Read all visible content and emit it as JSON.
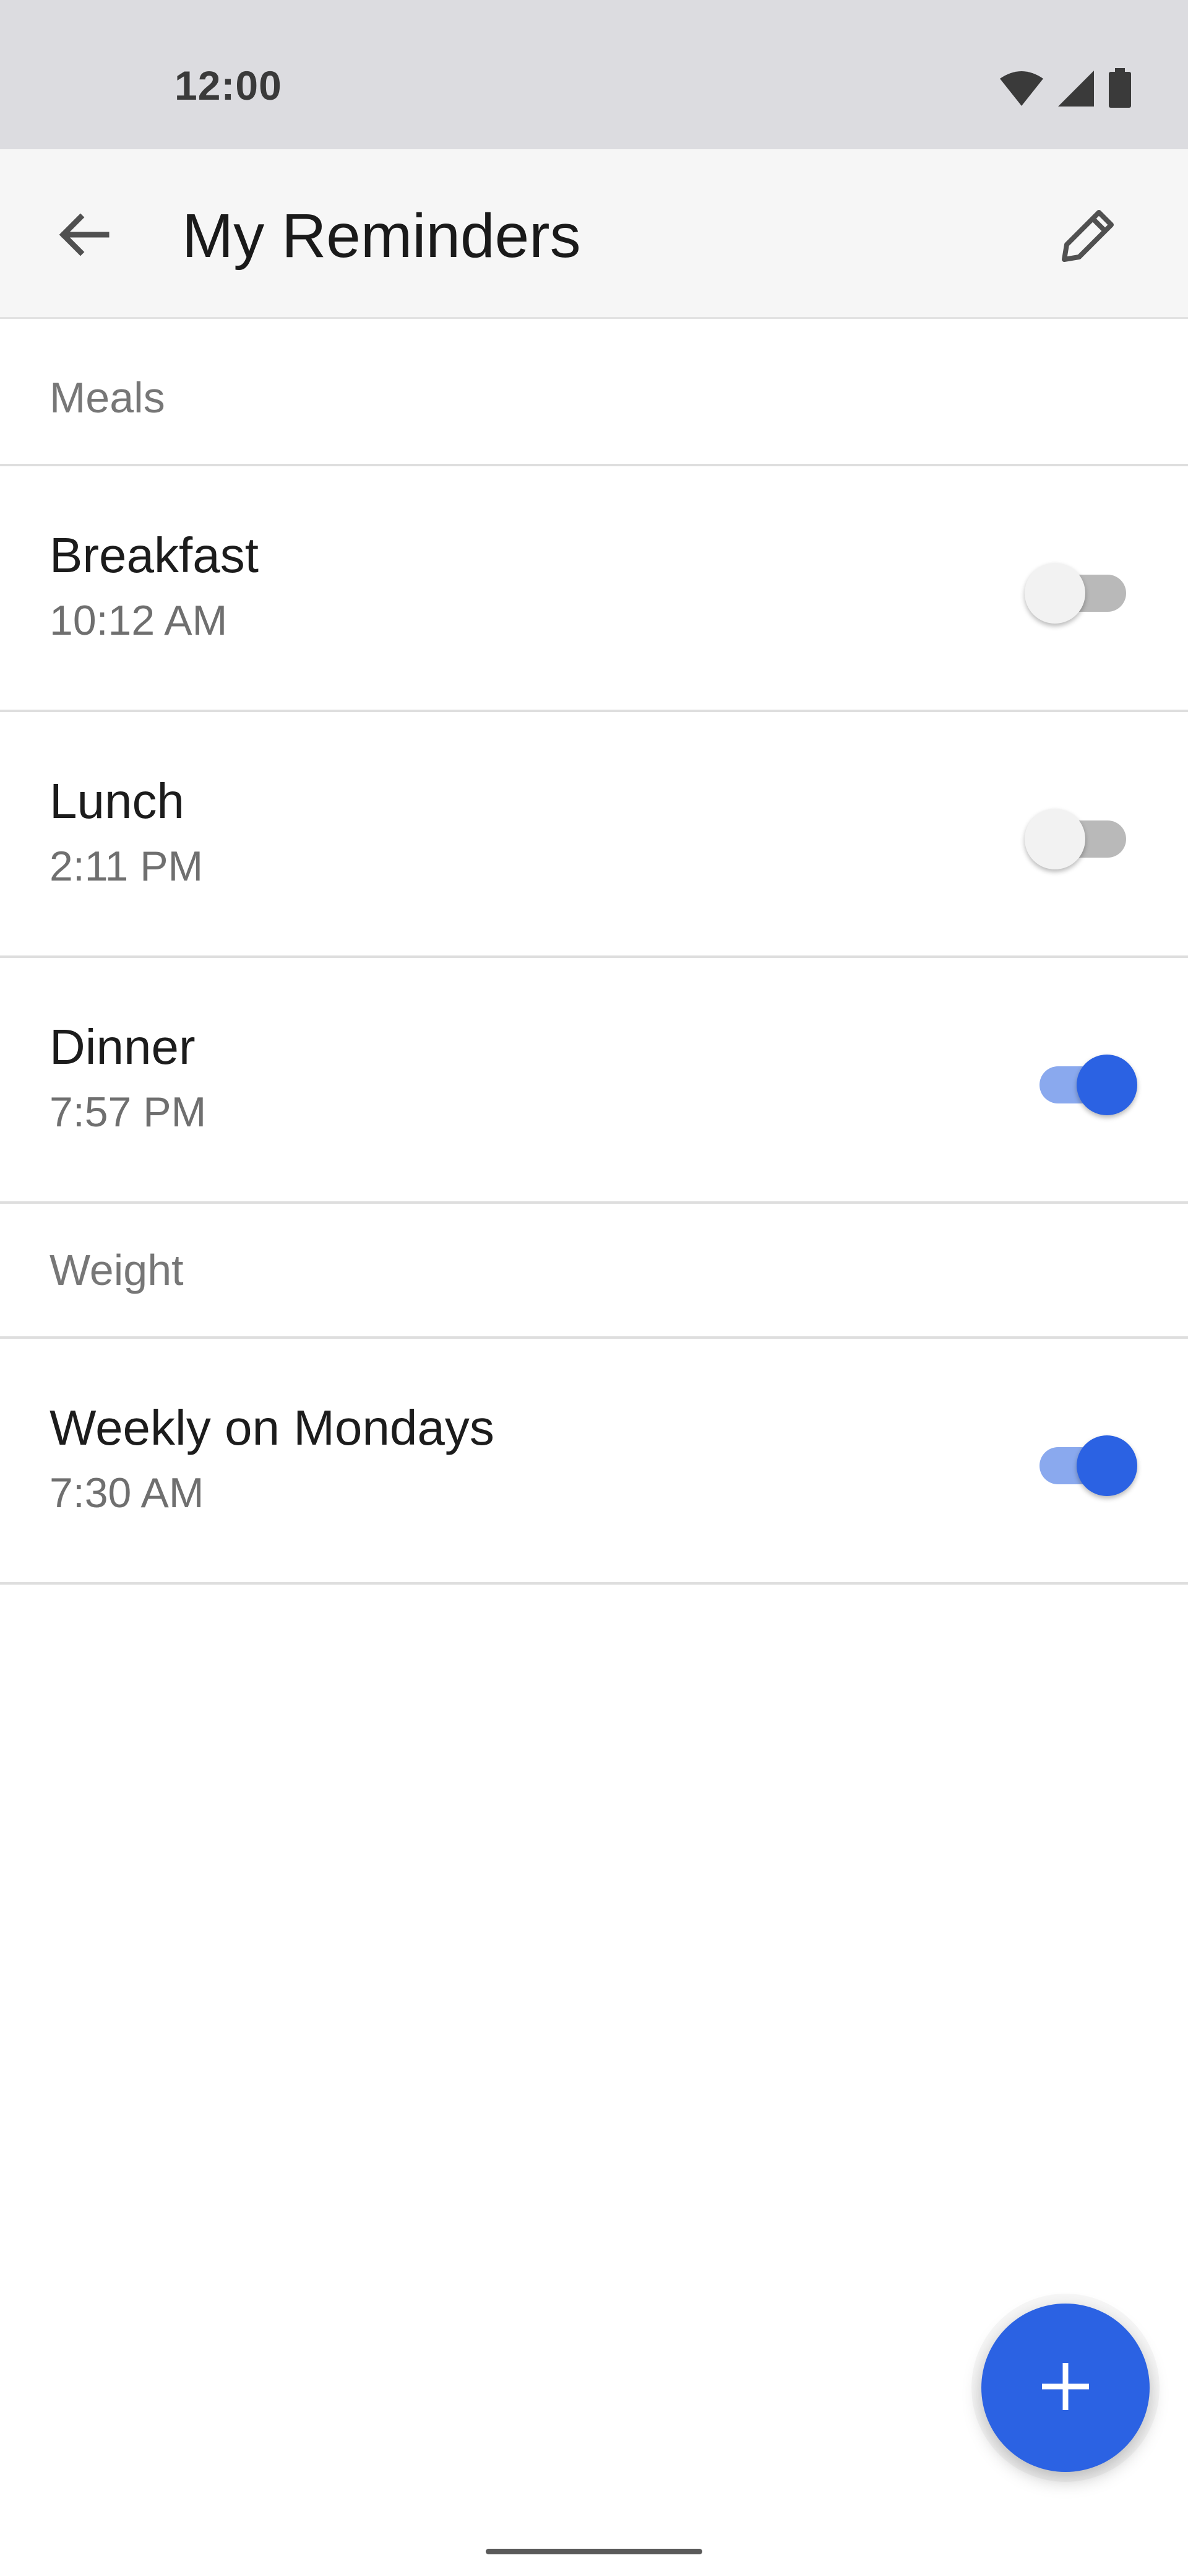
{
  "status_bar": {
    "time": "12:00",
    "icons": [
      "wifi-icon",
      "cellular-signal-icon",
      "battery-icon"
    ]
  },
  "app_bar": {
    "title": "My Reminders",
    "back_icon": "arrow-back-icon",
    "edit_icon": "pencil-edit-icon"
  },
  "sections": [
    {
      "header": "Meals",
      "items": [
        {
          "title": "Breakfast",
          "time": "10:12 AM",
          "enabled": false
        },
        {
          "title": "Lunch",
          "time": "2:11 PM",
          "enabled": false
        },
        {
          "title": "Dinner",
          "time": "7:57 PM",
          "enabled": true
        }
      ]
    },
    {
      "header": "Weight",
      "items": [
        {
          "title": "Weekly on Mondays",
          "time": "7:30 AM",
          "enabled": true
        }
      ]
    }
  ],
  "fab": {
    "icon": "plus-icon"
  },
  "colors": {
    "accent": "#2b62e3",
    "accent_track": "#8aa9ee",
    "status_bar_bg": "#dcdce0",
    "app_bar_bg": "#f6f6f6"
  }
}
